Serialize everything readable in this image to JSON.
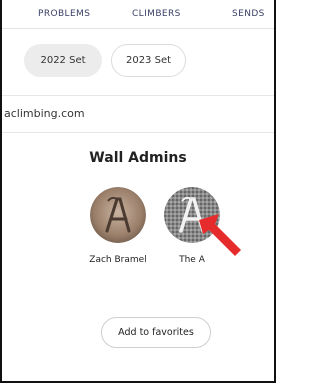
{
  "nav": {
    "items": [
      {
        "label": "PROBLEMS"
      },
      {
        "label": "CLIMBERS"
      },
      {
        "label": "SENDS"
      }
    ]
  },
  "sets": {
    "items": [
      {
        "label": "2022 Set",
        "selected": true
      },
      {
        "label": "2023 Set",
        "selected": false
      }
    ]
  },
  "website": {
    "text": "aclimbing.com"
  },
  "admins_section": {
    "title": "Wall Admins"
  },
  "admins": [
    {
      "name": "Zach Bramel",
      "avatar_letter": "A"
    },
    {
      "name": "The A",
      "avatar_letter": "A"
    }
  ],
  "favorites_button": {
    "label": "Add to favorites"
  },
  "colors": {
    "nav_text": "#3a3f66",
    "selected_pill": "#ececec",
    "annotation_arrow": "#e52b2b"
  }
}
